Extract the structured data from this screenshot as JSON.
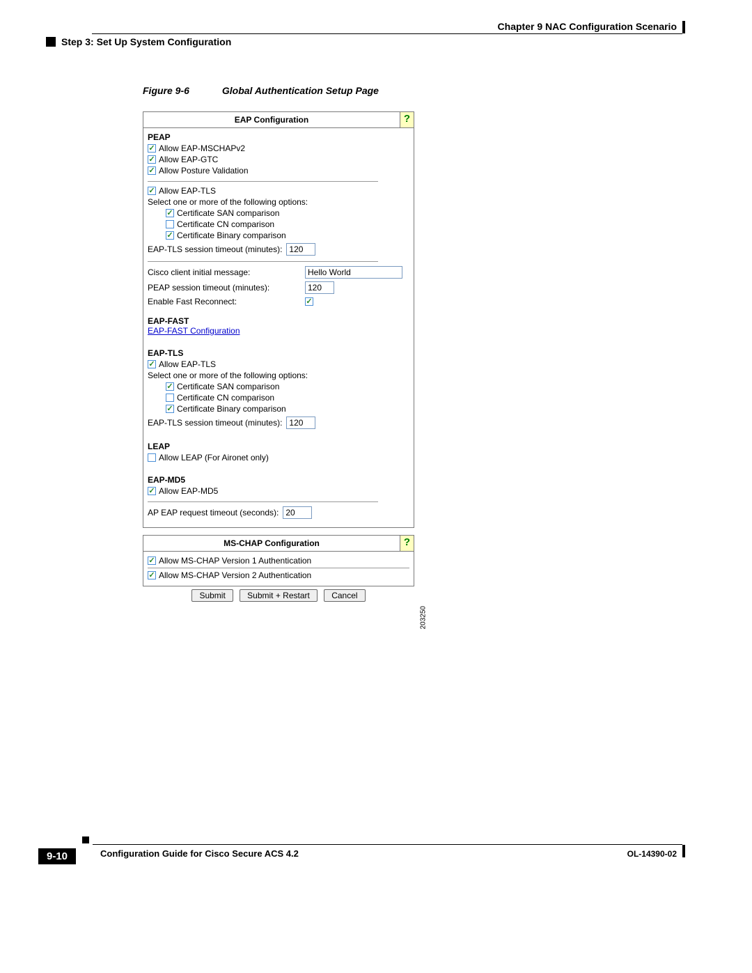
{
  "header": {
    "chapter": "Chapter 9    NAC Configuration Scenario",
    "step": "Step 3: Set Up System Configuration"
  },
  "figure": {
    "label": "Figure 9-6",
    "caption": "Global Authentication Setup Page"
  },
  "panel1": {
    "title": "EAP Configuration",
    "peap": {
      "heading": "PEAP",
      "allow_mschapv2": "Allow EAP-MSCHAPv2",
      "allow_gtc": "Allow EAP-GTC",
      "allow_posture": "Allow Posture Validation",
      "allow_eaptls": "Allow EAP-TLS",
      "select_hint": "Select one or more of the following options:",
      "cert_san": "Certificate SAN comparison",
      "cert_cn": "Certificate CN comparison",
      "cert_bin": "Certificate Binary comparison",
      "tls_timeout_label": "EAP-TLS session timeout (minutes):",
      "tls_timeout_value": "120",
      "cisco_msg_label": "Cisco client initial message:",
      "cisco_msg_value": "Hello World",
      "peap_timeout_label": "PEAP session timeout (minutes):",
      "peap_timeout_value": "120",
      "fast_reconnect_label": "Enable Fast Reconnect:"
    },
    "eapfast": {
      "heading": "EAP-FAST",
      "link": "EAP-FAST Configuration"
    },
    "eaptls": {
      "heading": "EAP-TLS",
      "allow": "Allow EAP-TLS",
      "select_hint": "Select one or more of the following options:",
      "cert_san": "Certificate SAN comparison",
      "cert_cn": "Certificate CN comparison",
      "cert_bin": "Certificate Binary comparison",
      "timeout_label": "EAP-TLS session timeout (minutes):",
      "timeout_value": "120"
    },
    "leap": {
      "heading": "LEAP",
      "allow": "Allow LEAP (For Aironet only)"
    },
    "eapmd5": {
      "heading": "EAP-MD5",
      "allow": "Allow EAP-MD5"
    },
    "ap_timeout_label": "AP EAP request timeout (seconds):",
    "ap_timeout_value": "20"
  },
  "panel2": {
    "title": "MS-CHAP Configuration",
    "v1": "Allow MS-CHAP Version 1 Authentication",
    "v2": "Allow MS-CHAP Version 2 Authentication"
  },
  "buttons": {
    "submit": "Submit",
    "submit_restart": "Submit + Restart",
    "cancel": "Cancel"
  },
  "image_id": "203250",
  "footer": {
    "guide": "Configuration Guide for Cisco Secure ACS 4.2",
    "page": "9-10",
    "docid": "OL-14390-02"
  }
}
